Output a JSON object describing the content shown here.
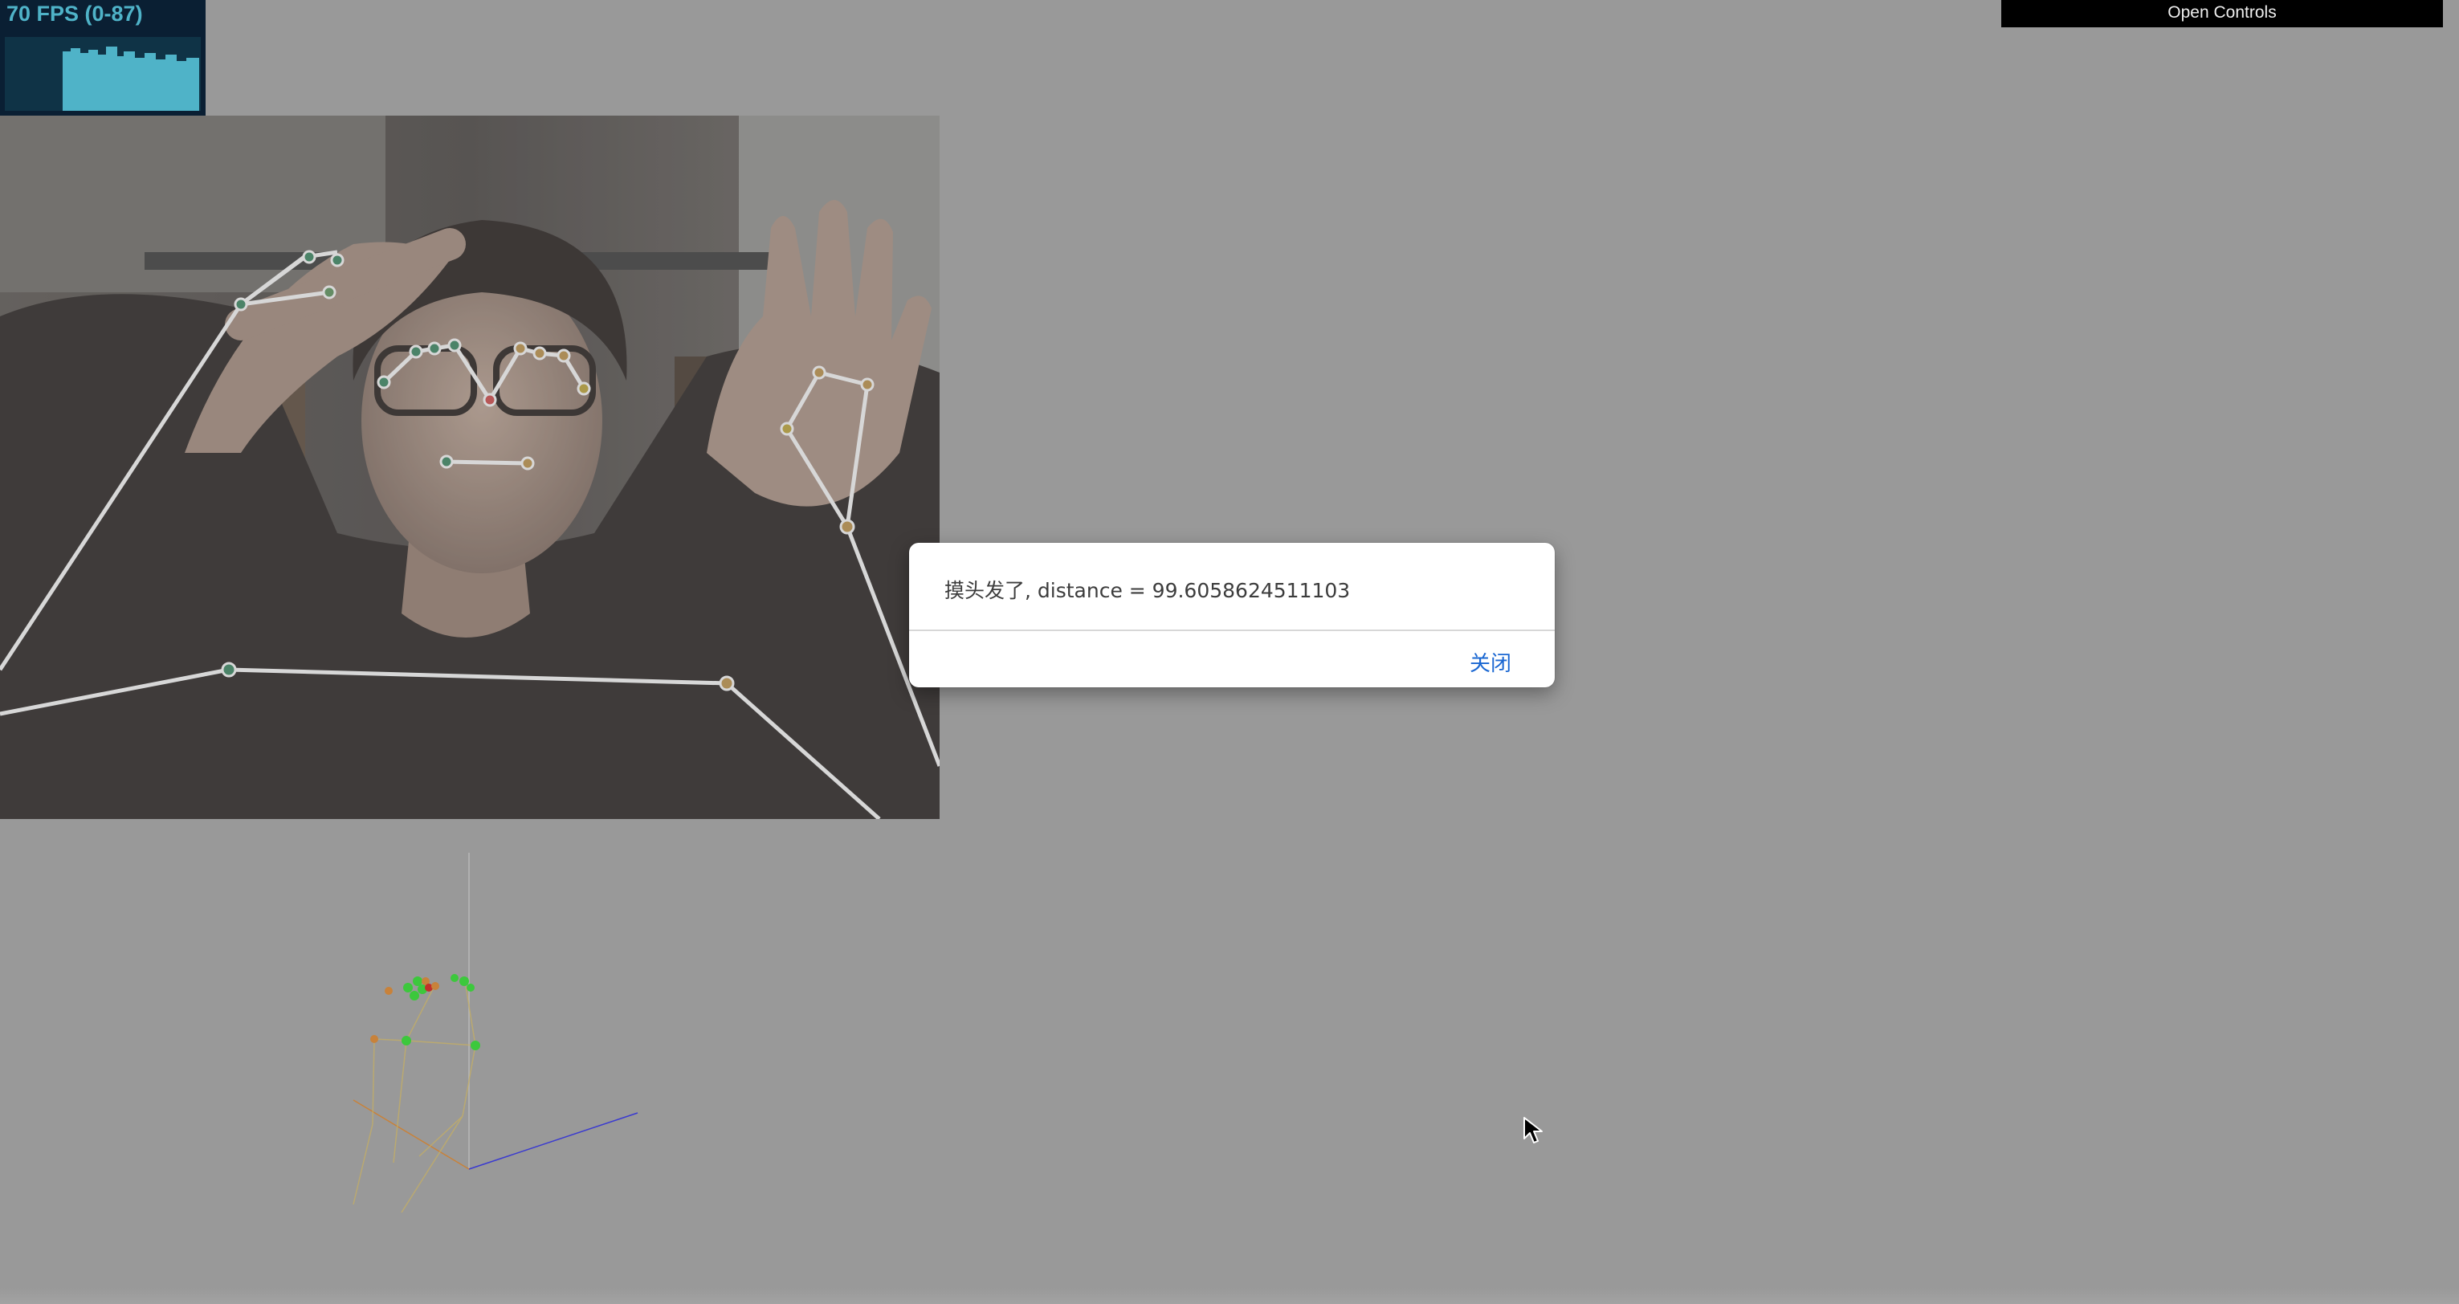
{
  "stats": {
    "fps_label": "70 FPS (0-87)"
  },
  "controls": {
    "open_label": "Open Controls"
  },
  "dialog": {
    "message": "摸头发了, distance = 99.6058624511103",
    "close_label": "关闭"
  },
  "colors": {
    "background": "#999999",
    "stats_bg": "#0a1f33",
    "stats_fg": "#4fb3c8",
    "landmark_line": "#e6e6e6",
    "dialog_link": "#1a67d2",
    "axis_blue": "#3a3ad0",
    "axis_orange": "#c8823a",
    "landmark_green": "#3cc83c"
  }
}
